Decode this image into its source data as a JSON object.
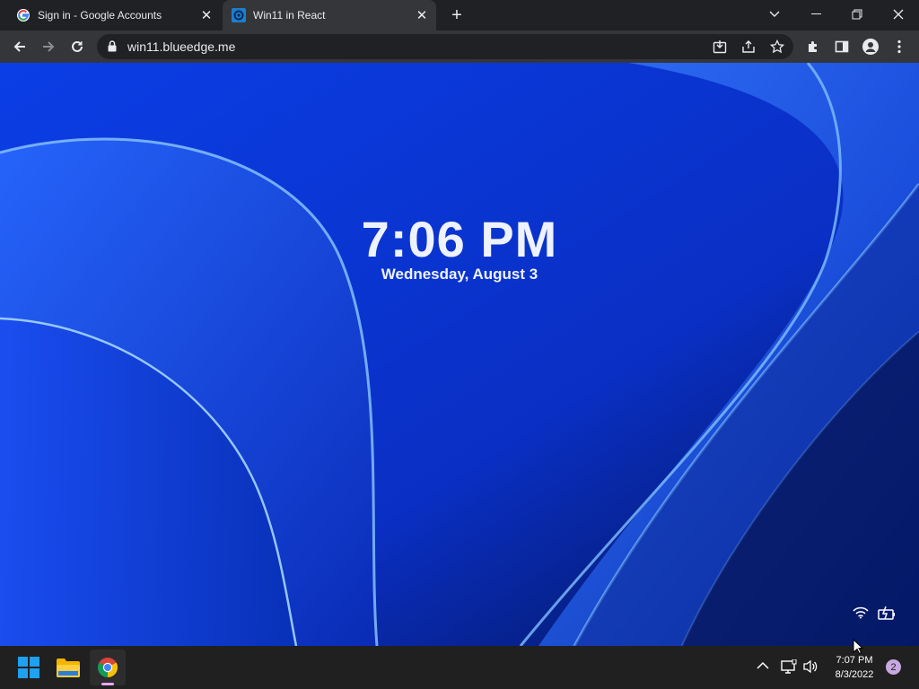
{
  "browser": {
    "tabs": [
      {
        "title": "Sign in - Google Accounts",
        "icon": "google-icon",
        "active": false
      },
      {
        "title": "Win11 in React",
        "icon": "win11-app-icon",
        "active": true
      }
    ],
    "address": "win11.blueedge.me"
  },
  "lockscreen": {
    "time": "7:06 PM",
    "date": "Wednesday, August 3"
  },
  "taskbar": {
    "apps": [
      "start-icon",
      "file-explorer-icon",
      "chrome-icon"
    ],
    "clock_time": "7:07 PM",
    "clock_date": "8/3/2022",
    "notification_count": "2"
  },
  "colors": {
    "wallpaper": "#0a3bd8",
    "chrome_frame": "#202124",
    "chrome_toolbar": "#35363a",
    "taskbar": "#202020",
    "start_blue": "#1fa0f0"
  }
}
